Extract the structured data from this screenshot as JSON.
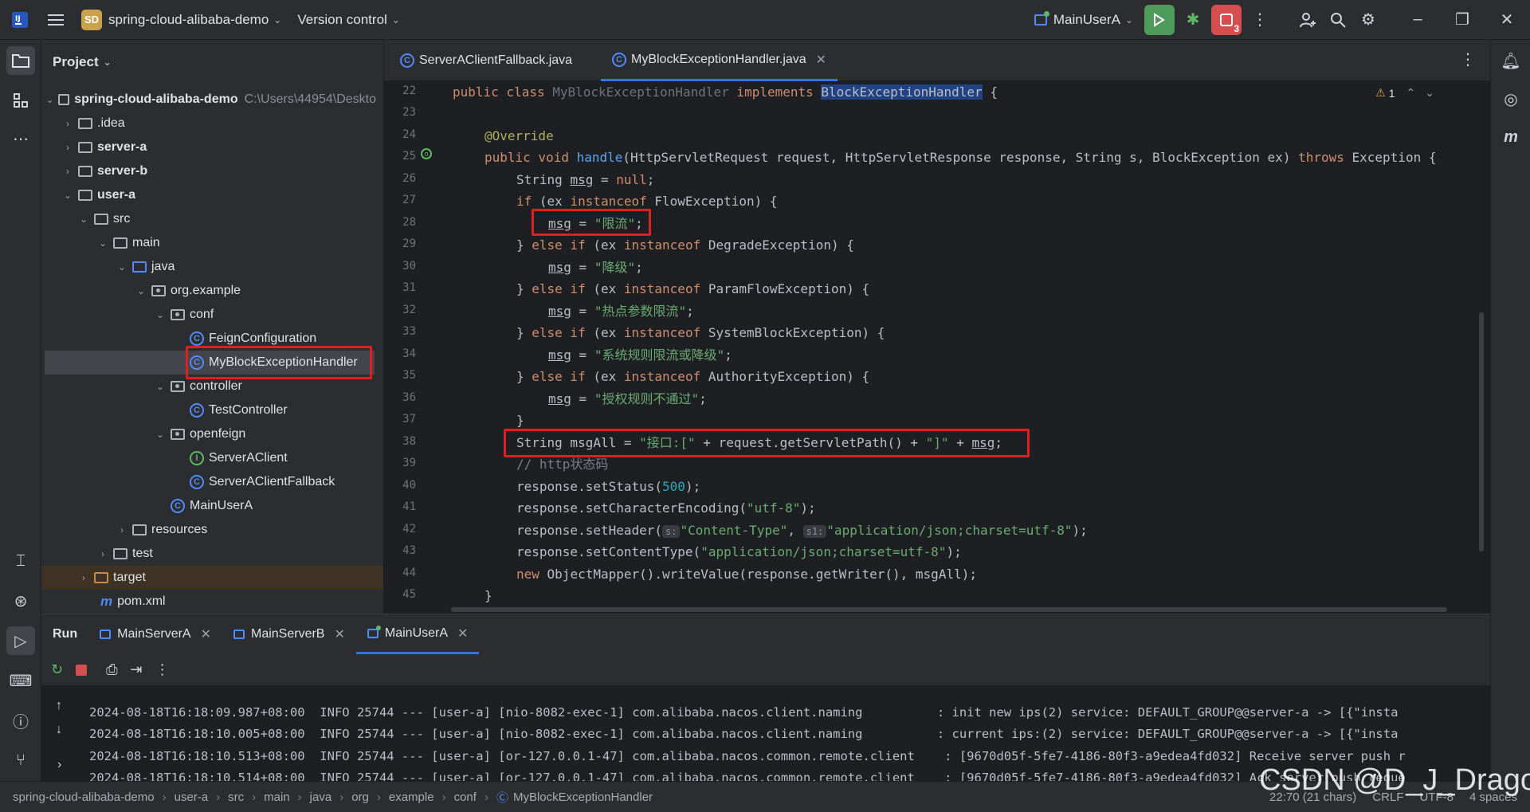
{
  "titlebar": {
    "badge": "SD",
    "project_name": "spring-cloud-alibaba-demo",
    "vcs": "Version control",
    "run_config": "MainUserA",
    "problems_count": "3"
  },
  "project_panel": {
    "title": "Project",
    "tree": [
      {
        "label": "spring-cloud-alibaba-demo",
        "extra": "C:\\Users\\44954\\Deskto"
      },
      {
        "label": ".idea"
      },
      {
        "label": "server-a"
      },
      {
        "label": "server-b"
      },
      {
        "label": "user-a"
      },
      {
        "label": "src"
      },
      {
        "label": "main"
      },
      {
        "label": "java"
      },
      {
        "label": "org.example"
      },
      {
        "label": "conf"
      },
      {
        "label": "FeignConfiguration"
      },
      {
        "label": "MyBlockExceptionHandler"
      },
      {
        "label": "controller"
      },
      {
        "label": "TestController"
      },
      {
        "label": "openfeign"
      },
      {
        "label": "ServerAClient"
      },
      {
        "label": "ServerAClientFallback"
      },
      {
        "label": "MainUserA"
      },
      {
        "label": "resources"
      },
      {
        "label": "test"
      },
      {
        "label": "target"
      },
      {
        "label": "pom.xml"
      }
    ]
  },
  "editor": {
    "tabs": [
      {
        "label": "ServerAClientFallback.java"
      },
      {
        "label": "MyBlockExceptionHandler.java"
      }
    ],
    "inspection_count": "1",
    "line_numbers": [
      "22",
      "23",
      "24",
      "25",
      "26",
      "27",
      "28",
      "29",
      "30",
      "31",
      "32",
      "33",
      "34",
      "35",
      "36",
      "37",
      "38",
      "39",
      "40",
      "41",
      "42",
      "43",
      "44",
      "45"
    ],
    "code": {
      "l22a": "public class ",
      "l22b": "MyBlockExceptionHandler",
      "l22c": " implements ",
      "l22d": "BlockExceptionHandler",
      "l22e": " {",
      "l24": "@Override",
      "l25a": "public void ",
      "l25b": "handle",
      "l25c": "(HttpServletRequest request, HttpServletResponse response, String s, BlockException ex) ",
      "l25d": "throws",
      "l25e": " Exception {",
      "l26a": "String ",
      "l26b": "msg",
      "l26c": " = ",
      "l26d": "null",
      "l26e": ";",
      "l27a": "if",
      "l27b": " (ex ",
      "l27c": "instanceof",
      "l27d": " FlowException) {",
      "l28a": "msg",
      "l28b": " = ",
      "l28c": "\"限流\"",
      "l28d": ";",
      "l29a": "} ",
      "l29b": "else if",
      "l29c": " (ex ",
      "l29d": "instanceof",
      "l29e": " DegradeException) {",
      "l30a": "msg",
      "l30b": " = ",
      "l30c": "\"降级\"",
      "l30d": ";",
      "l31a": "} ",
      "l31b": "else if",
      "l31c": " (ex ",
      "l31d": "instanceof",
      "l31e": " ParamFlowException) {",
      "l32a": "msg",
      "l32b": " = ",
      "l32c": "\"热点参数限流\"",
      "l32d": ";",
      "l33a": "} ",
      "l33b": "else if",
      "l33c": " (ex ",
      "l33d": "instanceof",
      "l33e": " SystemBlockException) {",
      "l34a": "msg",
      "l34b": " = ",
      "l34c": "\"系统规则限流或降级\"",
      "l34d": ";",
      "l35a": "} ",
      "l35b": "else if",
      "l35c": " (ex ",
      "l35d": "instanceof",
      "l35e": " AuthorityException) {",
      "l36a": "msg",
      "l36b": " = ",
      "l36c": "\"授权规则不通过\"",
      "l36d": ";",
      "l37": "}",
      "l38a": "String msgAll = ",
      "l38b": "\"接口:[\"",
      "l38c": " + request.getServletPath() + ",
      "l38d": "\"]\"",
      "l38e": " + ",
      "l38f": "msg",
      "l38g": ";",
      "l39": "// http状态码",
      "l40a": "response.setStatus(",
      "l40b": "500",
      "l40c": ");",
      "l41a": "response.setCharacterEncoding(",
      "l41b": "\"utf-8\"",
      "l41c": ");",
      "l42a": "response.setHeader(",
      "l42h1": "s:",
      "l42b": "\"Content-Type\"",
      "l42c": ", ",
      "l42h2": "s1:",
      "l42d": "\"application/json;charset=utf-8\"",
      "l42e": ");",
      "l43a": "response.setContentType(",
      "l43b": "\"application/json;charset=utf-8\"",
      "l43c": ");",
      "l44a": "new",
      "l44b": " ObjectMapper().writeValue(response.getWriter(), msgAll);",
      "l45": "}"
    }
  },
  "run_panel": {
    "title": "Run",
    "tabs": [
      {
        "label": "MainServerA"
      },
      {
        "label": "MainServerB"
      },
      {
        "label": "MainUserA"
      }
    ],
    "log_lines": [
      "2024-08-18T16:18:09.987+08:00  INFO 25744 --- [user-a] [nio-8082-exec-1] com.alibaba.nacos.client.naming          : init new ips(2) service: DEFAULT_GROUP@@server-a -> [{\"insta",
      "2024-08-18T16:18:10.005+08:00  INFO 25744 --- [user-a] [nio-8082-exec-1] com.alibaba.nacos.client.naming          : current ips:(2) service: DEFAULT_GROUP@@server-a -> [{\"insta",
      "2024-08-18T16:18:10.513+08:00  INFO 25744 --- [user-a] [or-127.0.0.1-47] com.alibaba.nacos.common.remote.client    : [9670d05f-5fe7-4186-80f3-a9edea4fd032] Receive server push r",
      "2024-08-18T16:18:10.514+08:00  INFO 25744 --- [user-a] [or-127.0.0.1-47] com.alibaba.nacos.common.remote.client    : [9670d05f-5fe7-4186-80f3-a9edea4fd032] Ack server push reque"
    ]
  },
  "statusbar": {
    "crumbs": [
      "spring-cloud-alibaba-demo",
      "user-a",
      "src",
      "main",
      "java",
      "org",
      "example",
      "conf",
      "MyBlockExceptionHandler"
    ],
    "position": "22:70 (21 chars)",
    "line_sep": "CRLF",
    "encoding": "UTF-8",
    "indent": "4 spaces"
  },
  "watermark": "CSDN @D_J_Dragon"
}
